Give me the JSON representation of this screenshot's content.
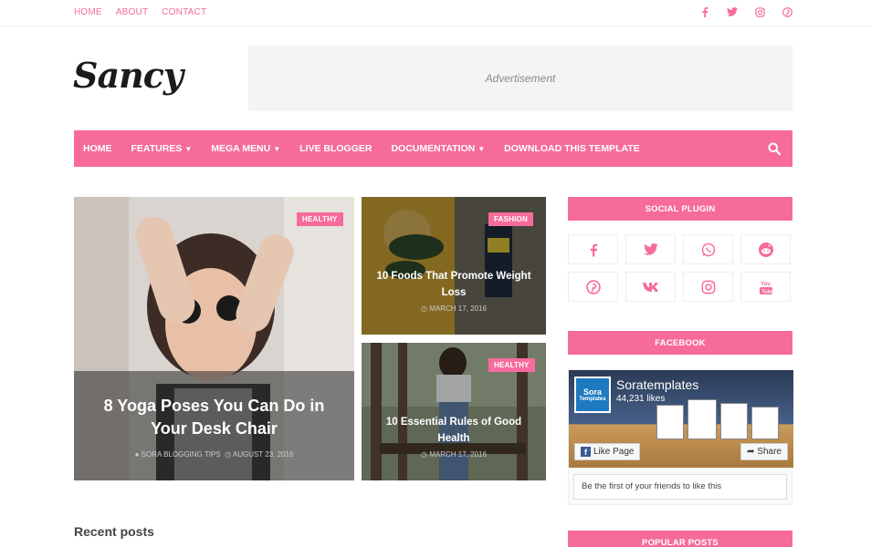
{
  "topbar": {
    "links": [
      "HOME",
      "ABOUT",
      "CONTACT"
    ],
    "social_icons": [
      "facebook-icon",
      "twitter-icon",
      "instagram-icon",
      "pinterest-icon"
    ]
  },
  "header": {
    "logo": "Sancy",
    "ad_label": "Advertisement"
  },
  "nav": {
    "items": [
      {
        "label": "HOME",
        "dropdown": false
      },
      {
        "label": "FEATURES",
        "dropdown": true
      },
      {
        "label": "MEGA MENU",
        "dropdown": true
      },
      {
        "label": "LIVE BLOGGER",
        "dropdown": false
      },
      {
        "label": "DOCUMENTATION",
        "dropdown": true
      },
      {
        "label": "DOWNLOAD THIS TEMPLATE",
        "dropdown": false
      }
    ],
    "search_icon": "search-icon"
  },
  "featured": {
    "main": {
      "badge": "HEALTHY",
      "title": "8 Yoga Poses You Can Do in Your Desk Chair",
      "author": "SORA BLOGGING TIPS",
      "date": "AUGUST 23, 2016"
    },
    "side": [
      {
        "badge": "FASHION",
        "title": "10 Foods That Promote Weight Loss",
        "date": "MARCH 17, 2016"
      },
      {
        "badge": "HEALTHY",
        "title": "10 Essential Rules of Good Health",
        "date": "MARCH 17, 2016"
      }
    ]
  },
  "recent_posts": {
    "heading": "Recent posts"
  },
  "sidebar": {
    "social_plugin": {
      "title": "SOCIAL PLUGIN",
      "icons": [
        "facebook-icon",
        "twitter-icon",
        "whatsapp-icon",
        "reddit-icon",
        "pinterest-icon",
        "vk-icon",
        "instagram-icon",
        "youtube-icon"
      ]
    },
    "facebook": {
      "title": "FACEBOOK",
      "logo_line1": "Sora",
      "logo_line2": "Templates",
      "page_name": "Soratemplates",
      "likes": "44,231 likes",
      "like_button": "Like Page",
      "share_button": "Share",
      "friends_text": "Be the first of your friends to like this"
    },
    "popular_posts": {
      "title": "POPULAR POSTS"
    }
  },
  "colors": {
    "accent": "#f66b9c"
  }
}
